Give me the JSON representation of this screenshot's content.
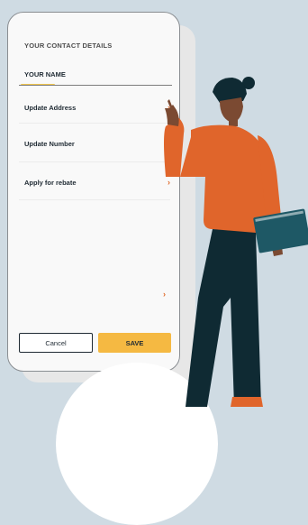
{
  "contact": {
    "section_title": "YOUR CONTACT DETAILS",
    "name_label": "YOUR NAME",
    "menu": [
      {
        "label": "Update Address",
        "chevron": "›"
      },
      {
        "label": "Update Number",
        "chevron": ""
      },
      {
        "label": "Apply for rebate",
        "chevron": "›"
      }
    ],
    "lone_chevron": "›"
  },
  "actions": {
    "cancel_label": "Cancel",
    "save_label": "SAVE"
  },
  "colors": {
    "accent_yellow": "#f5b942",
    "chevron_orange": "#e06a2a",
    "sweater_orange": "#e0652b",
    "pants_dark": "#0f2a33",
    "background": "#cfdbe3"
  },
  "icons": {
    "menu_chevron": "chevron-right-icon"
  }
}
